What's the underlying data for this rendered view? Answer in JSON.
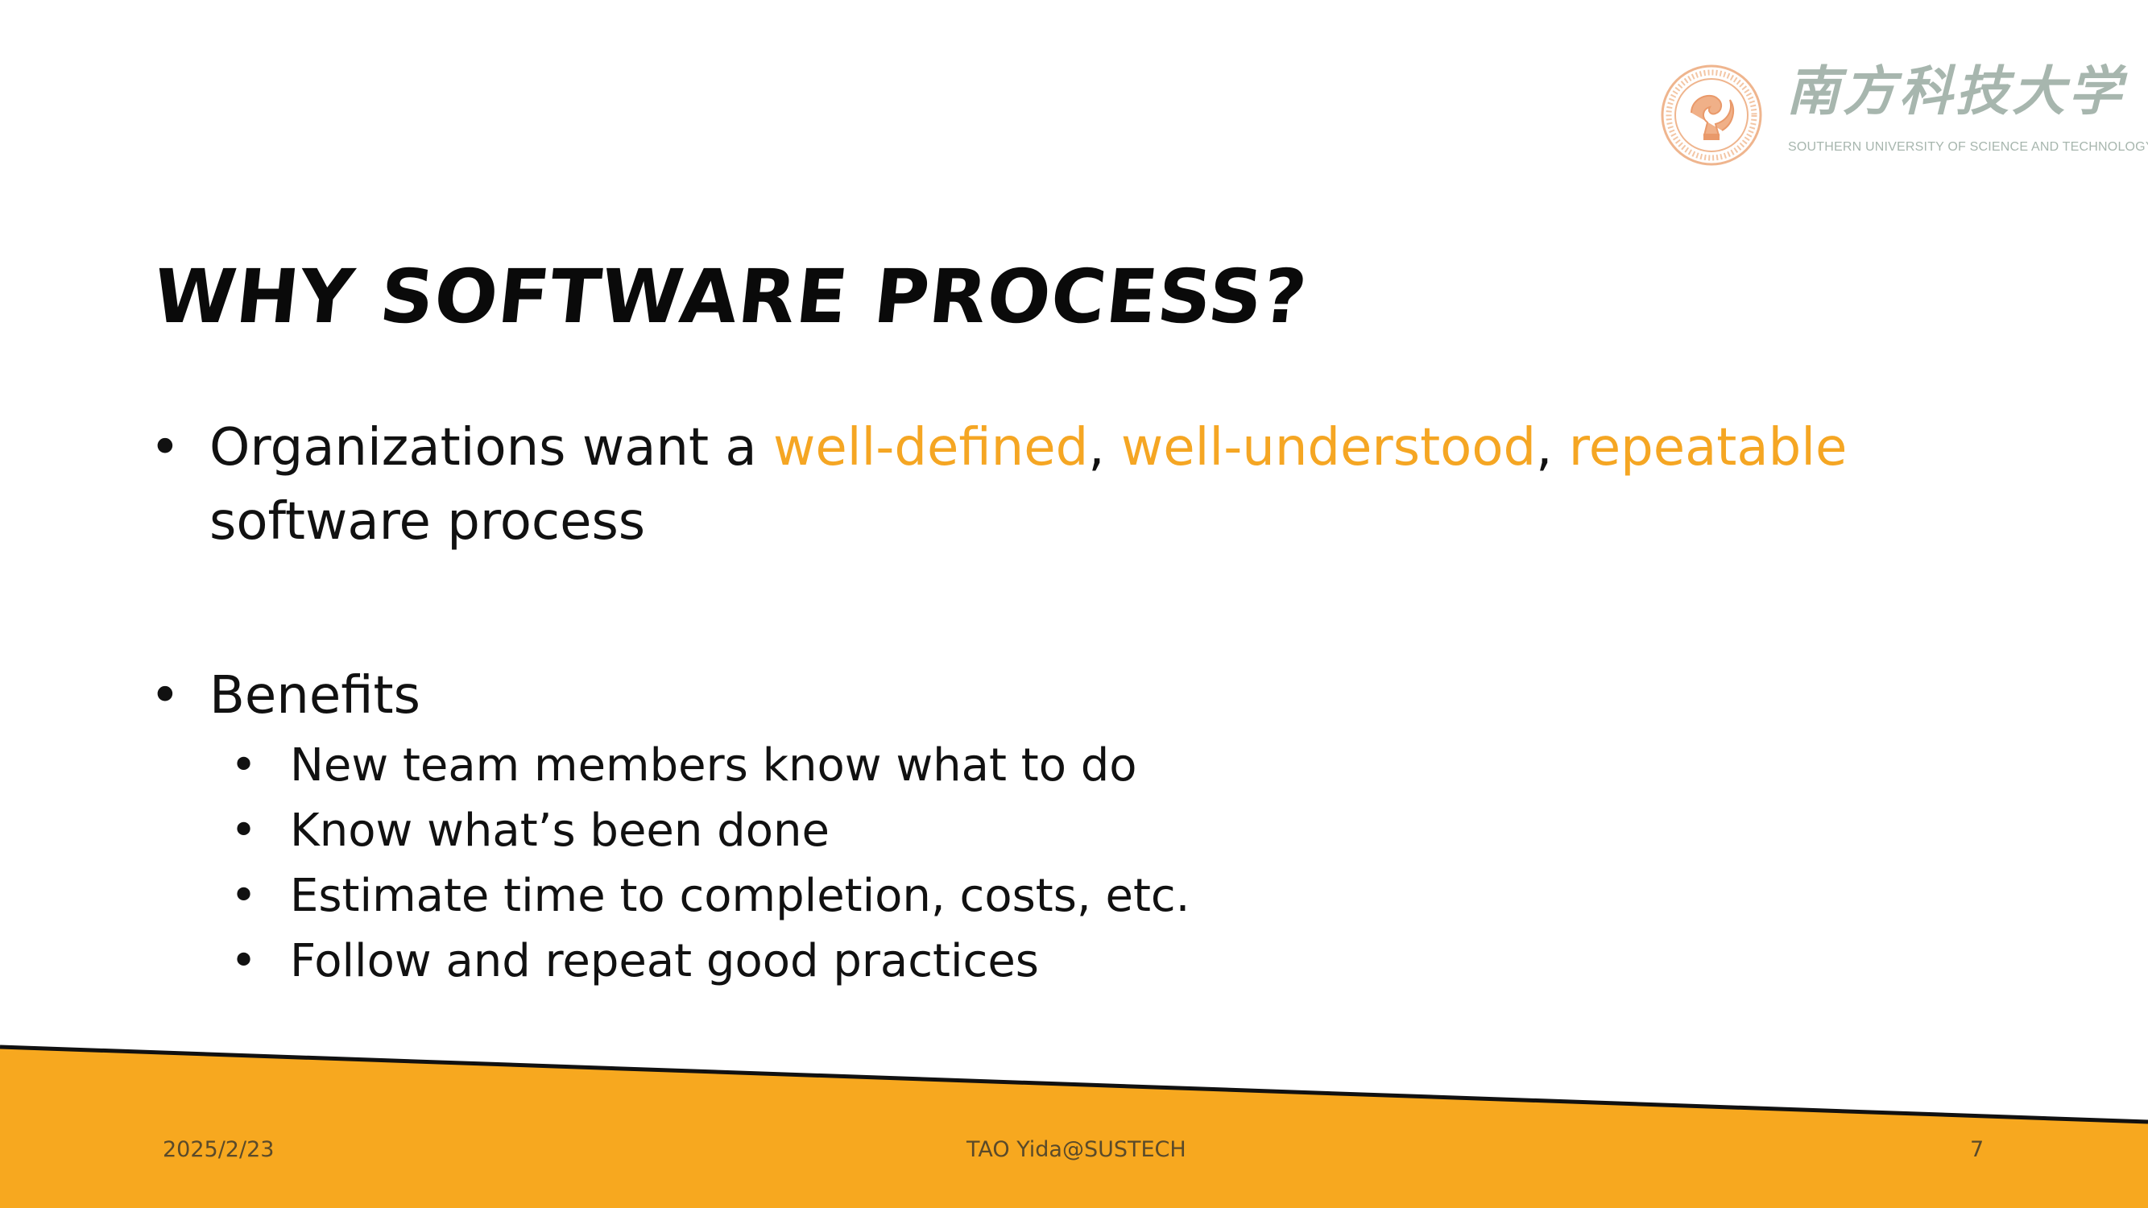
{
  "logo": {
    "chinese_name": "南方科技大学",
    "english_name": "SOUTHERN UNIVERSITY OF SCIENCE AND TECHNOLOGY"
  },
  "title": "Why Software Process?",
  "bullets": {
    "b1_text": "Organizations want a ",
    "b1_hl1": "well-defined",
    "b1_sep1": ", ",
    "b1_hl2": "well-understood",
    "b1_sep2": ", ",
    "b1_hl3": "repeatable",
    "b1_tail": " software process",
    "b2_text": "Benefits",
    "sub_items": [
      "New team members know what to do",
      "Know what’s been done",
      "Estimate time to completion, costs, etc.",
      "Follow and repeat good practices"
    ]
  },
  "footer": {
    "date": "2025/2/23",
    "author": "TAO Yida@SUSTECH",
    "page": "7"
  },
  "colors": {
    "accent": "#f5a623",
    "band": "#f7a81f",
    "logo": "#e9a87a"
  }
}
